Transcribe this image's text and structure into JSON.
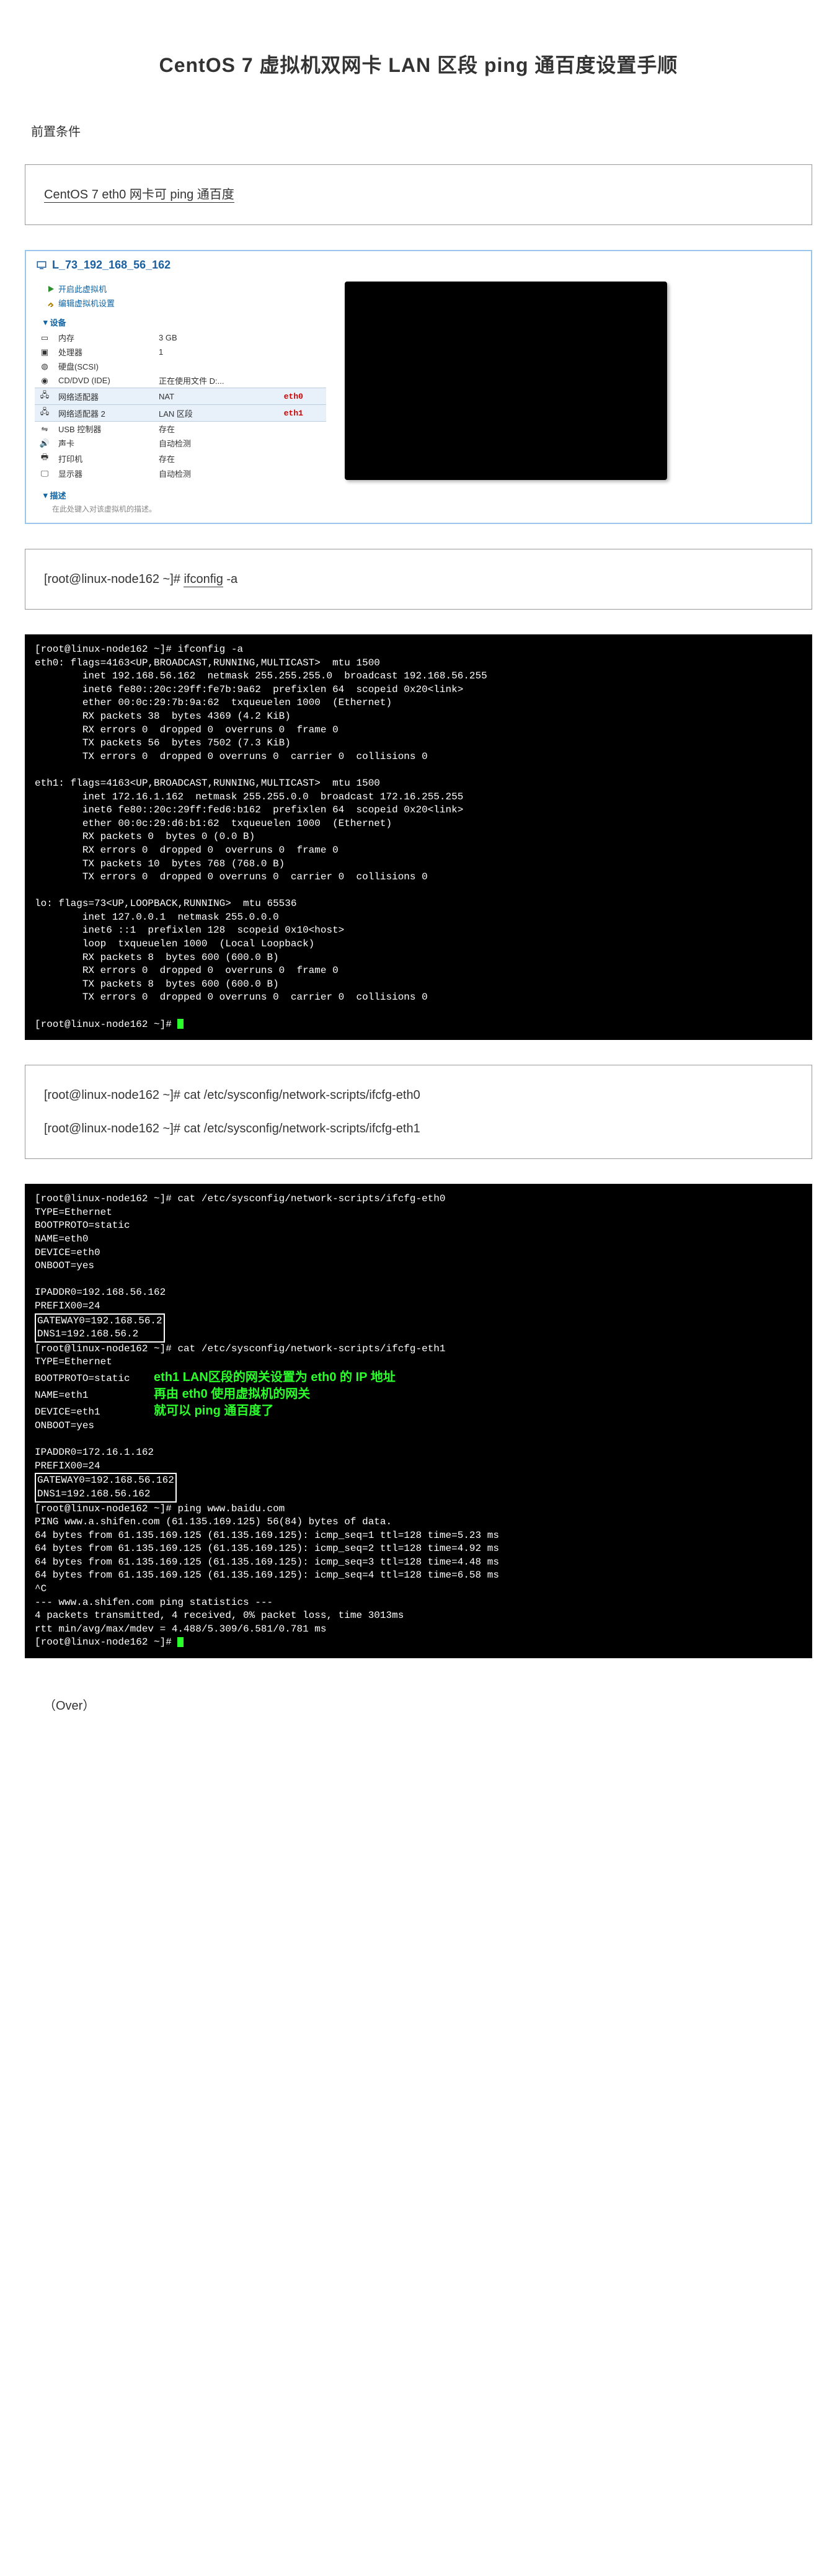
{
  "title": "CentOS 7 虚拟机双网卡 LAN 区段 ping 通百度设置手顺",
  "precondition_label": "前置条件",
  "box1": {
    "text": "CentOS 7 eth0 网卡可 ping 通百度"
  },
  "vm": {
    "title": "L_73_192_168_56_162",
    "play_label": "开启此虚拟机",
    "edit_label": "编辑虚拟机设置",
    "devices_section": "设备",
    "desc_section": "描述",
    "desc_placeholder": "在此处键入对该虚拟机的描述。",
    "devices": [
      {
        "icon": "mem",
        "name": "内存",
        "val": "3 GB",
        "ann": ""
      },
      {
        "icon": "cpu",
        "name": "处理器",
        "val": "1",
        "ann": ""
      },
      {
        "icon": "hdd",
        "name": "硬盘(SCSI)",
        "val": "",
        "ann": ""
      },
      {
        "icon": "cd",
        "name": "CD/DVD (IDE)",
        "val": "正在使用文件 D:...",
        "ann": ""
      },
      {
        "icon": "net",
        "name": "网络适配器",
        "val": "NAT",
        "ann": "eth0",
        "hl": true
      },
      {
        "icon": "net",
        "name": "网络适配器 2",
        "val": "LAN 区段",
        "ann": "eth1",
        "hl": true
      },
      {
        "icon": "usb",
        "name": "USB 控制器",
        "val": "存在",
        "ann": ""
      },
      {
        "icon": "snd",
        "name": "声卡",
        "val": "自动检测",
        "ann": ""
      },
      {
        "icon": "prn",
        "name": "打印机",
        "val": "存在",
        "ann": ""
      },
      {
        "icon": "disp",
        "name": "显示器",
        "val": "自动检测",
        "ann": ""
      }
    ]
  },
  "box2": {
    "prompt": "[root@linux-node162 ~]# ",
    "cmd": "ifconfig",
    "flag": " -a"
  },
  "terminal1": "[root@linux-node162 ~]# ifconfig -a\neth0: flags=4163<UP,BROADCAST,RUNNING,MULTICAST>  mtu 1500\n        inet 192.168.56.162  netmask 255.255.255.0  broadcast 192.168.56.255\n        inet6 fe80::20c:29ff:fe7b:9a62  prefixlen 64  scopeid 0x20<link>\n        ether 00:0c:29:7b:9a:62  txqueuelen 1000  (Ethernet)\n        RX packets 38  bytes 4369 (4.2 KiB)\n        RX errors 0  dropped 0  overruns 0  frame 0\n        TX packets 56  bytes 7502 (7.3 KiB)\n        TX errors 0  dropped 0 overruns 0  carrier 0  collisions 0\n\neth1: flags=4163<UP,BROADCAST,RUNNING,MULTICAST>  mtu 1500\n        inet 172.16.1.162  netmask 255.255.0.0  broadcast 172.16.255.255\n        inet6 fe80::20c:29ff:fed6:b162  prefixlen 64  scopeid 0x20<link>\n        ether 00:0c:29:d6:b1:62  txqueuelen 1000  (Ethernet)\n        RX packets 0  bytes 0 (0.0 B)\n        RX errors 0  dropped 0  overruns 0  frame 0\n        TX packets 10  bytes 768 (768.0 B)\n        TX errors 0  dropped 0 overruns 0  carrier 0  collisions 0\n\nlo: flags=73<UP,LOOPBACK,RUNNING>  mtu 65536\n        inet 127.0.0.1  netmask 255.0.0.0\n        inet6 ::1  prefixlen 128  scopeid 0x10<host>\n        loop  txqueuelen 1000  (Local Loopback)\n        RX packets 8  bytes 600 (600.0 B)\n        RX errors 0  dropped 0  overruns 0  frame 0\n        TX packets 8  bytes 600 (600.0 B)\n        TX errors 0  dropped 0 overruns 0  carrier 0  collisions 0\n\n[root@linux-node162 ~]# ",
  "box3": {
    "line1": "[root@linux-node162 ~]# cat /etc/sysconfig/network-scripts/ifcfg-eth0",
    "line2": "[root@linux-node162 ~]# cat /etc/sysconfig/network-scripts/ifcfg-eth1"
  },
  "terminal2": {
    "block1_prompt": "[root@linux-node162 ~]# cat /etc/sysconfig/network-scripts/ifcfg-eth0",
    "block1_body": "TYPE=Ethernet\nBOOTPROTO=static\nNAME=eth0\nDEVICE=eth0\nONBOOT=yes\n\nIPADDR0=192.168.56.162\nPREFIX00=24",
    "block1_gw": "GATEWAY0=192.168.56.2\nDNS1=192.168.56.2",
    "block2_prompt": "[root@linux-node162 ~]# cat /etc/sysconfig/network-scripts/ifcfg-eth1",
    "block2_body_left": "TYPE=Ethernet\nBOOTPROTO=static\nNAME=eth1\nDEVICE=eth1\nONBOOT=yes",
    "annotation_lines": [
      "eth1 LAN区段的网关设置为 eth0 的 IP 地址",
      "再由 eth0 使用虚拟机的网关",
      "就可以 ping 通百度了"
    ],
    "block2_rest": "\nIPADDR0=172.16.1.162\nPREFIX00=24",
    "block2_gw": "GATEWAY0=192.168.56.162\nDNS1=192.168.56.162",
    "ping_section": "[root@linux-node162 ~]# ping www.baidu.com\nPING www.a.shifen.com (61.135.169.125) 56(84) bytes of data.\n64 bytes from 61.135.169.125 (61.135.169.125): icmp_seq=1 ttl=128 time=5.23 ms\n64 bytes from 61.135.169.125 (61.135.169.125): icmp_seq=2 ttl=128 time=4.92 ms\n64 bytes from 61.135.169.125 (61.135.169.125): icmp_seq=3 ttl=128 time=4.48 ms\n64 bytes from 61.135.169.125 (61.135.169.125): icmp_seq=4 ttl=128 time=6.58 ms\n^C\n--- www.a.shifen.com ping statistics ---\n4 packets transmitted, 4 received, 0% packet loss, time 3013ms\nrtt min/avg/max/mdev = 4.488/5.309/6.581/0.781 ms\n[root@linux-node162 ~]# "
  },
  "over_label": "（Over）"
}
